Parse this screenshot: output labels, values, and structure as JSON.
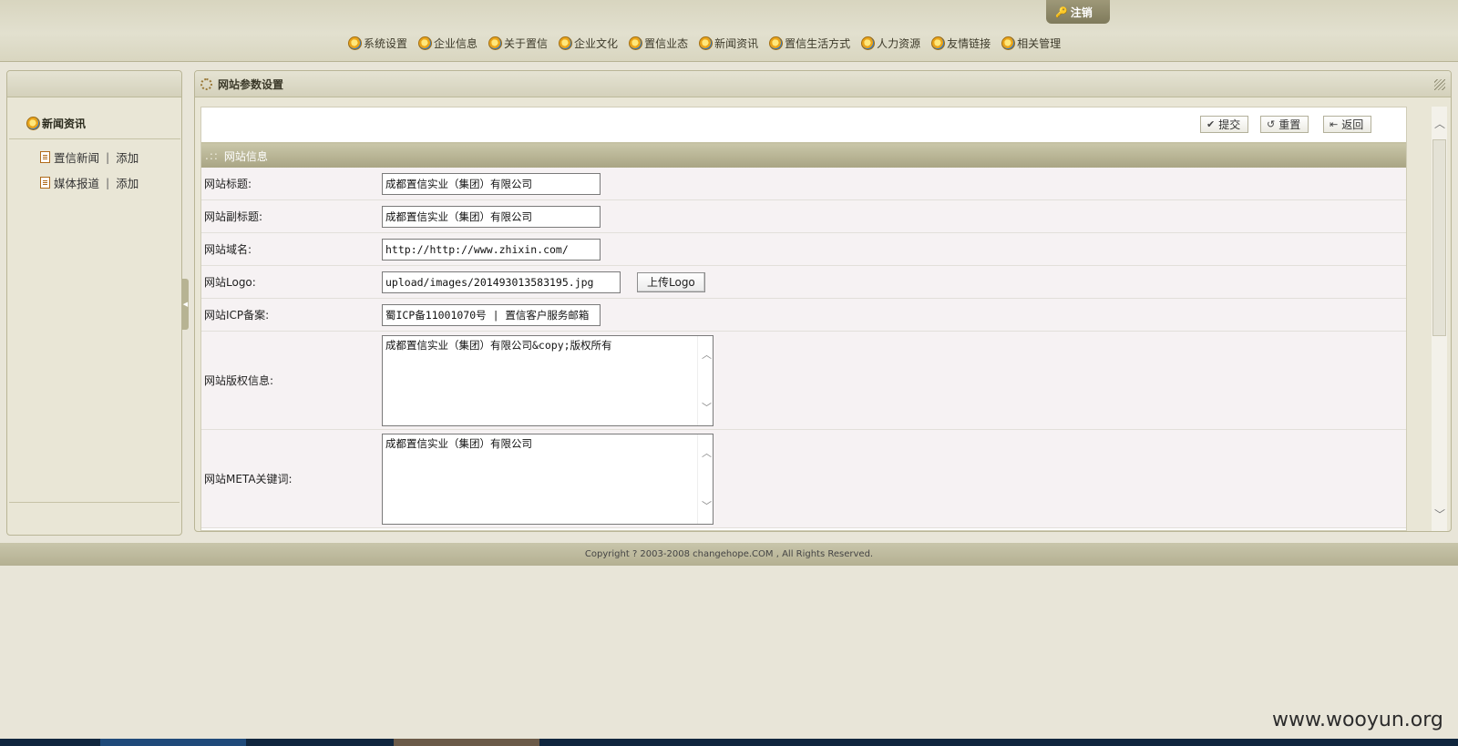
{
  "header": {
    "logout_label": "注销",
    "nav": [
      "系统设置",
      "企业信息",
      "关于置信",
      "企业文化",
      "置信业态",
      "新闻资讯",
      "置信生活方式",
      "人力资源",
      "友情链接",
      "相关管理"
    ]
  },
  "sidebar": {
    "section_title": "新闻资讯",
    "items": [
      {
        "label": "置信新闻",
        "add": "添加"
      },
      {
        "label": "媒体报道",
        "add": "添加"
      }
    ]
  },
  "main": {
    "panel_title": "网站参数设置",
    "toolbar": {
      "submit": "提交",
      "reset": "重置",
      "back": "返回"
    },
    "section_title": "网站信息",
    "section_dots": ".::",
    "fields": {
      "title": {
        "label": "网站标题:",
        "value": "成都置信实业（集团）有限公司"
      },
      "subtitle": {
        "label": "网站副标题:",
        "value": "成都置信实业（集团）有限公司"
      },
      "domain": {
        "label": "网站域名:",
        "value": "http://http://www.zhixin.com/"
      },
      "logo": {
        "label": "网站Logo:",
        "value": "upload/images/201493013583195.jpg",
        "upload_label": "上传Logo"
      },
      "icp": {
        "label": "网站ICP备案:",
        "value": "蜀ICP备11001070号 | 置信客户服务邮箱"
      },
      "copyright": {
        "label": "网站版权信息:",
        "value": "成都置信实业（集团）有限公司&copy;版权所有"
      },
      "meta_keywords": {
        "label": "网站META关键词:",
        "value": "成都置信实业（集团）有限公司"
      }
    }
  },
  "footer": {
    "text": "Copyright ? 2003-2008 changehope.COM , All Rights Reserved."
  },
  "watermark": "www.wooyun.org",
  "colors": {
    "accent": "#b4b092",
    "background": "#e8e5d8",
    "row_bg": "#f6f2f3"
  }
}
